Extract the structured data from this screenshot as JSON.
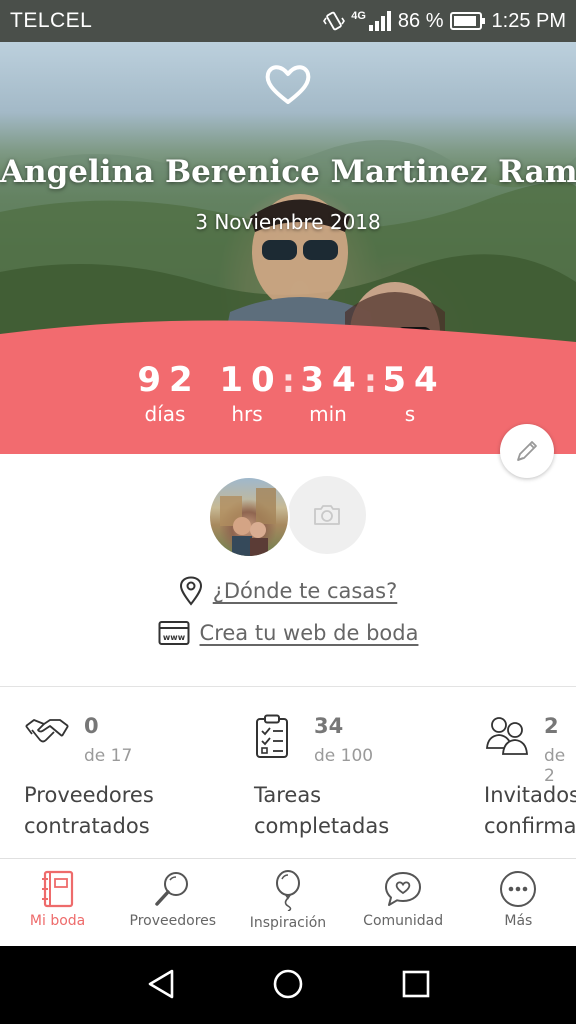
{
  "status_bar": {
    "carrier": "TELCEL",
    "network": "4G",
    "battery": "86 %",
    "time": "1:25 PM"
  },
  "hero": {
    "name": "Angelina Berenice Martinez Ramos",
    "date": "3 Noviembre 2018",
    "icon": "heart-icon"
  },
  "countdown": {
    "days": {
      "value": "92",
      "label": "días"
    },
    "hours": {
      "value": "10",
      "label": "hrs"
    },
    "minutes": {
      "value": "34",
      "label": "min"
    },
    "seconds": {
      "value": "54",
      "label": "s"
    },
    "separator": ":"
  },
  "links": {
    "where": "¿Dónde te casas?",
    "website": "Crea tu web de boda"
  },
  "stats": [
    {
      "count": "0",
      "of": "de 17",
      "label_line1": "Proveedores",
      "label_line2": "contratados",
      "icon": "handshake-icon"
    },
    {
      "count": "34",
      "of": "de 100",
      "label_line1": "Tareas",
      "label_line2": "completadas",
      "icon": "checklist-icon"
    },
    {
      "count": "2",
      "of": "de 2",
      "label_line1": "Invitados",
      "label_line2": "confirmados",
      "icon": "guests-icon"
    }
  ],
  "bottom_nav": [
    {
      "label": "Mi boda",
      "icon": "notebook-icon",
      "active": true
    },
    {
      "label": "Proveedores",
      "icon": "magnifier-icon",
      "active": false
    },
    {
      "label": "Inspiración",
      "icon": "balloon-icon",
      "active": false
    },
    {
      "label": "Comunidad",
      "icon": "chat-heart-icon",
      "active": false
    },
    {
      "label": "Más",
      "icon": "more-icon",
      "active": false
    }
  ],
  "colors": {
    "accent": "#f26b6f",
    "nav_active": "#ee6b6b",
    "text": "#444444"
  }
}
